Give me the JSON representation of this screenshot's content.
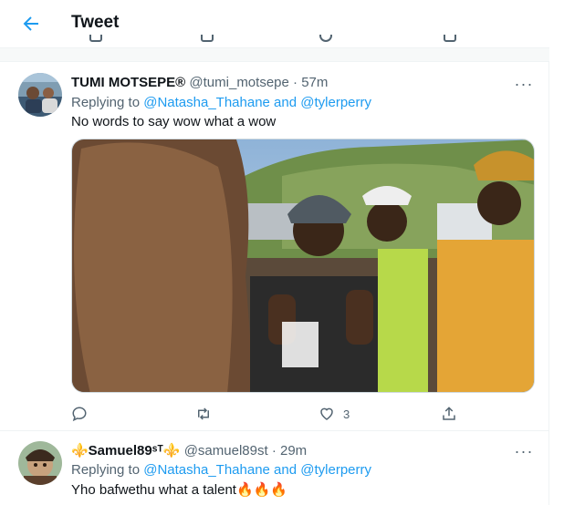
{
  "header": {
    "title": "Tweet"
  },
  "tweets": [
    {
      "name": "TUMI MOTSEPE®",
      "handle": "@tumi_motsepe",
      "dot": "·",
      "time": "57m",
      "replying_prefix": "Replying to ",
      "replying_user1": "@Natasha_Thahane",
      "replying_and": " and ",
      "replying_user2": "@tylerperry",
      "text": "No words to say wow what a wow",
      "has_media": true,
      "likes": "3"
    },
    {
      "name": "⚜️Samuel89ˢᵀ⚜️",
      "handle": "@samuel89st",
      "dot": "·",
      "time": "29m",
      "replying_prefix": "Replying to ",
      "replying_user1": "@Natasha_Thahane",
      "replying_and": " and ",
      "replying_user2": "@tylerperry",
      "text": "Yho bafwethu what a talent🔥🔥🔥"
    }
  ],
  "more_label": "···",
  "icons": {
    "back": "arrow-left-icon",
    "reply": "reply-icon",
    "retweet": "retweet-icon",
    "like": "heart-icon",
    "share": "share-icon",
    "more": "more-icon"
  },
  "colors": {
    "accent": "#1d9bf0",
    "muted": "#536471",
    "text": "#0f1419"
  }
}
